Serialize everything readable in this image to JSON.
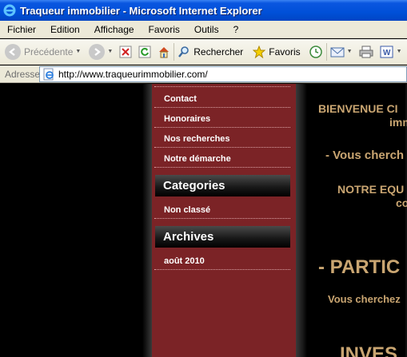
{
  "window": {
    "title": "Traqueur immobilier - Microsoft Internet Explorer"
  },
  "menu": {
    "items": [
      "Fichier",
      "Edition",
      "Affichage",
      "Favoris",
      "Outils",
      "?"
    ]
  },
  "toolbar": {
    "back_label": "Précédente",
    "search_label": "Rechercher",
    "favorites_label": "Favoris"
  },
  "address": {
    "label": "Adresse",
    "url": "http://www.traqueurimmobilier.com/"
  },
  "sidebar": {
    "links": [
      "Contact",
      "Honoraires",
      "Nos recherches",
      "Notre démarche"
    ],
    "categories_title": "Categories",
    "categories": [
      "Non classé"
    ],
    "archives_title": "Archives",
    "archives": [
      "août 2010"
    ]
  },
  "main": {
    "line1": "BIENVENUE CI",
    "line2": "imm",
    "line3": "- Vous cherch",
    "line4": "NOTRE EQU",
    "line5": "co",
    "line6": "- PARTIC",
    "line7": "Vous cherchez",
    "line8": "INVES"
  },
  "colors": {
    "sidebar": "#7b2326",
    "accent_text": "#c9a571",
    "titlebar": "#0050d8"
  }
}
